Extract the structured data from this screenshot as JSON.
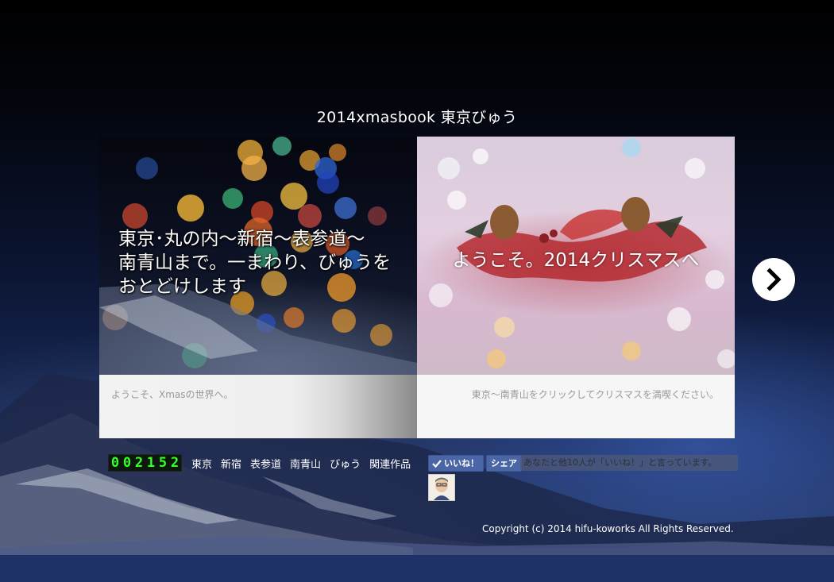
{
  "book": {
    "title": "2014xmasbook 東京びゅう",
    "left_page": {
      "caption_lines": [
        "東京･丸の内～新宿～表参道～",
        "南青山まで。一まわり、びゅうを",
        "おとどけします"
      ],
      "footer": "ようこそ、Xmasの世界へ。"
    },
    "right_page": {
      "caption": "ようこそ。2014クリスマスへ",
      "footer": "東京～南青山をクリックしてクリスマスを満喫ください。"
    },
    "next_icon": "chevron-right-icon"
  },
  "counter": {
    "digits": [
      "0",
      "0",
      "2",
      "1",
      "5",
      "2"
    ]
  },
  "nav": {
    "links": [
      "東京",
      "新宿",
      "表参道",
      "南青山",
      "びゅう",
      "関連作品"
    ]
  },
  "social": {
    "like_label": "いいね！",
    "share_label": "シェア",
    "like_count_text": "あなたと他10人が「いいね！」と言っています。"
  },
  "footer": {
    "copyright": "Copyright (c) 2014 hifu-koworks All Rights Reserved."
  },
  "colors": {
    "counter_digit": "#37ff2e",
    "facebook_blue": "#4b66a7",
    "bottom_bar": "#1e3268"
  }
}
